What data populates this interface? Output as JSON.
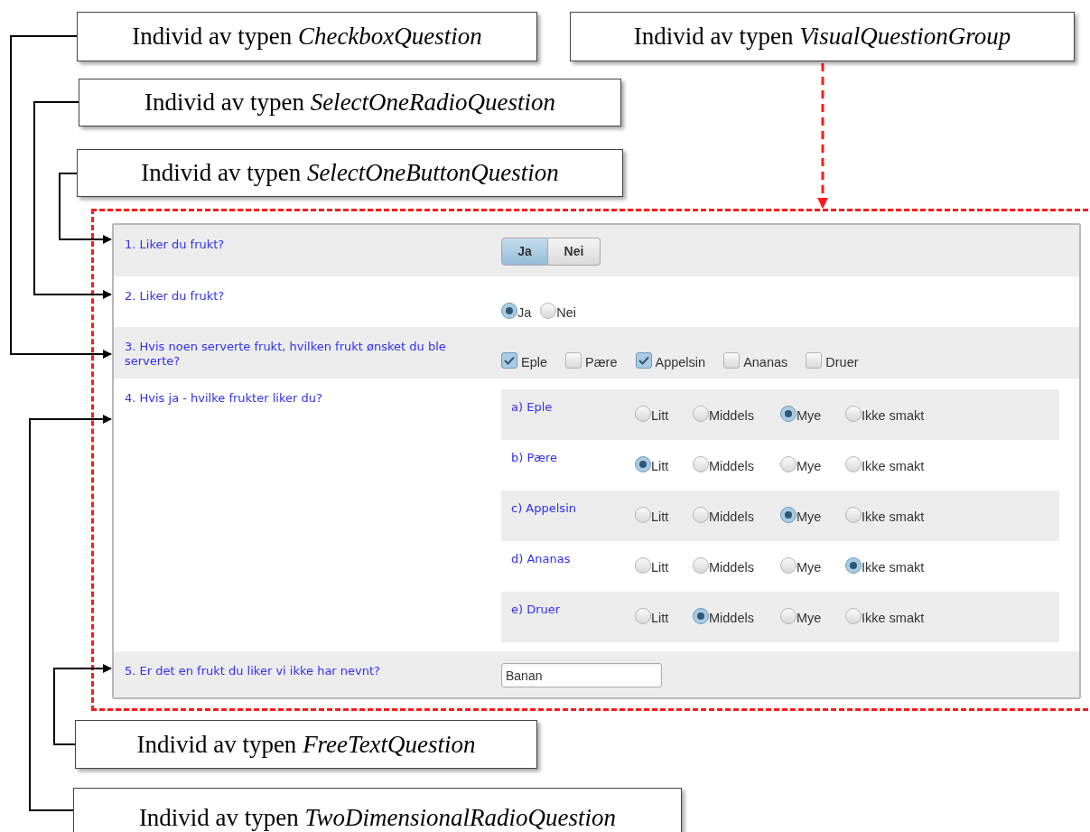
{
  "callouts": [
    {
      "text": "Individ av typen *CheckboxQuestion*"
    },
    {
      "text": "Individ av typen *VisualQuestionGroup*"
    },
    {
      "text": "Individ av typen *SelectOneRadioQuestion*"
    },
    {
      "text": "Individ av typen *SelectOneButtonQuestion*"
    },
    {
      "text": "Individ av typen *FreeTextQuestion*"
    },
    {
      "text": "Individ av typen *TwoDimensionalRadioQuestion*"
    }
  ],
  "questions": [
    {
      "kind": "buttons",
      "label": "1. Liker du frukt?",
      "options": [
        {
          "label": "Ja",
          "selected": true
        },
        {
          "label": "Nei",
          "selected": false
        }
      ]
    },
    {
      "kind": "radio",
      "label": "2. Liker du frukt?",
      "options": [
        {
          "label": "Ja",
          "selected": true
        },
        {
          "label": "Nei",
          "selected": false
        }
      ]
    },
    {
      "kind": "checkbox",
      "label": "3. Hvis noen serverte frukt, hvilken frukt ønsket du ble serverte?",
      "options": [
        {
          "label": "Eple",
          "checked": true
        },
        {
          "label": "Pære",
          "checked": false
        },
        {
          "label": "Appelsin",
          "checked": true
        },
        {
          "label": "Ananas",
          "checked": false
        },
        {
          "label": "Druer",
          "checked": false
        }
      ]
    },
    {
      "kind": "matrix",
      "label": "4. Hvis ja - hvilke frukter liker du?",
      "rows": [
        {
          "label": "a) Eple",
          "options": [
            {
              "label": "Litt",
              "selected": false
            },
            {
              "label": "Middels",
              "selected": false
            },
            {
              "label": "Mye",
              "selected": true
            },
            {
              "label": "Ikke smakt",
              "selected": false
            }
          ]
        },
        {
          "label": "b) Pære",
          "options": [
            {
              "label": "Litt",
              "selected": true
            },
            {
              "label": "Middels",
              "selected": false
            },
            {
              "label": "Mye",
              "selected": false
            },
            {
              "label": "Ikke smakt",
              "selected": false
            }
          ]
        },
        {
          "label": "c) Appelsin",
          "options": [
            {
              "label": "Litt",
              "selected": false
            },
            {
              "label": "Middels",
              "selected": false
            },
            {
              "label": "Mye",
              "selected": true
            },
            {
              "label": "Ikke smakt",
              "selected": false
            }
          ]
        },
        {
          "label": "d) Ananas",
          "options": [
            {
              "label": "Litt",
              "selected": false
            },
            {
              "label": "Middels",
              "selected": false
            },
            {
              "label": "Mye",
              "selected": false
            },
            {
              "label": "Ikke smakt",
              "selected": true
            }
          ]
        },
        {
          "label": "e) Druer",
          "options": [
            {
              "label": "Litt",
              "selected": false
            },
            {
              "label": "Middels",
              "selected": true
            },
            {
              "label": "Mye",
              "selected": false
            },
            {
              "label": "Ikke smakt",
              "selected": false
            }
          ]
        }
      ]
    },
    {
      "kind": "text",
      "label": "5. Er det en frukt du liker vi ikke har nevnt?",
      "value": "Banan"
    }
  ]
}
